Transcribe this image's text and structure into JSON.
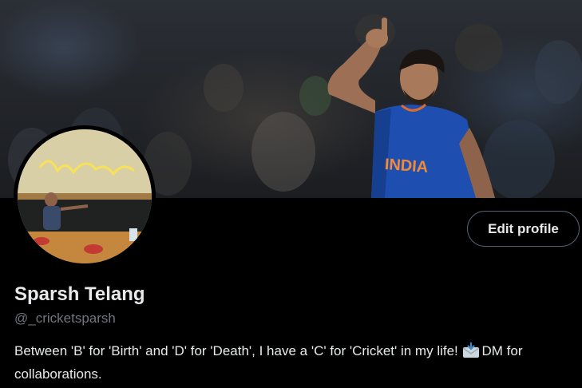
{
  "profile": {
    "display_name": "Sparsh Telang",
    "handle": "@_cricketsparsh",
    "bio_before_emoji": "Between 'B' for 'Birth' and 'D' for 'Death', I have a 'C' for 'Cricket' in my life!",
    "bio_emoji_icon": "incoming-envelope-icon",
    "bio_after_emoji": "DM for collaborations."
  },
  "actions": {
    "edit_profile_label": "Edit profile"
  },
  "banner": {
    "jersey_text": "INDIA"
  },
  "colors": {
    "background": "#000000",
    "primary_text": "#e7e9ea",
    "secondary_text": "#71767b",
    "button_border": "#536471",
    "jersey_blue": "#1e4fb0"
  }
}
